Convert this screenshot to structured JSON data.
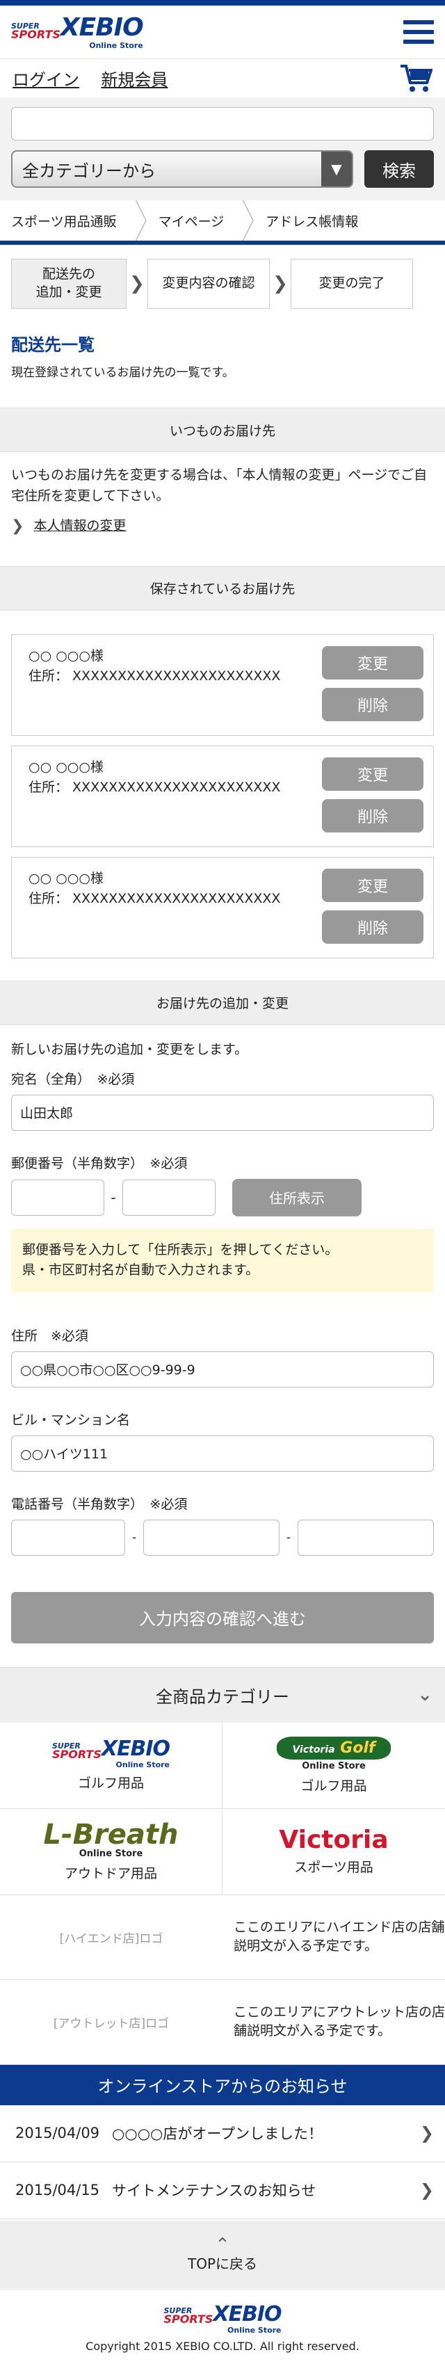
{
  "header": {
    "logo_super": "SUPER",
    "logo_sports": "SPORTS",
    "logo_xebio": "XEBIO",
    "logo_online": "Online Store"
  },
  "account": {
    "login": "ログイン",
    "register": "新規会員"
  },
  "search": {
    "placeholder": "",
    "category": "全カテゴリーから",
    "button": "検索"
  },
  "breadcrumb": [
    "スポーツ用品通販",
    "マイページ",
    "アドレス帳情報"
  ],
  "steps": [
    {
      "label": "配送先の\n追加・変更"
    },
    {
      "label": "変更内容の確認"
    },
    {
      "label": "変更の完了"
    }
  ],
  "page": {
    "title": "配送先一覧",
    "desc": "現在登録されているお届け先の一覧です。"
  },
  "usual": {
    "heading": "いつものお届け先",
    "text": "いつものお届け先を変更する場合は、「本人情報の変更」ページでご自宅住所を変更して下さい。",
    "link": "本人情報の変更"
  },
  "saved": {
    "heading": "保存されているお届け先",
    "entries": [
      {
        "name": "○○ ○○○様",
        "address": "住所： XXXXXXXXXXXXXXXXXXXXXXX"
      },
      {
        "name": "○○ ○○○様",
        "address": "住所： XXXXXXXXXXXXXXXXXXXXXXX"
      },
      {
        "name": "○○ ○○○様",
        "address": "住所： XXXXXXXXXXXXXXXXXXXXXXX"
      }
    ],
    "edit": "変更",
    "delete": "削除"
  },
  "form": {
    "heading": "お届け先の追加・変更",
    "intro": "新しいお届け先の追加・変更をします。",
    "name_label": "宛名（全角）　※必須",
    "name_value": "山田太郎",
    "zip_label": "郵便番号（半角数字）　※必須",
    "zip_dash": "-",
    "lookup": "住所表示",
    "notice": "郵便番号を入力して「住所表示」を押してください。\n県・市区町村名が自動で入力されます。",
    "addr_label": "住所　※必須",
    "addr_value": "○○県○○市○○区○○9-99-9",
    "bldg_label": "ビル・マンション名",
    "bldg_value": "○○ハイツ111",
    "tel_label": "電話番号（半角数字）　※必須",
    "tel_dash": "-",
    "confirm": "入力内容の確認へ進む"
  },
  "categories": {
    "heading": "全商品カテゴリー",
    "brands": [
      {
        "label": "ゴルフ用品",
        "logo": "SUPER SPORTS XEBIO Online Store"
      },
      {
        "label": "ゴルフ用品",
        "logo": "Victoria Golf Online Store"
      },
      {
        "label": "アウトドア用品",
        "logo": "L-Breath Online Store"
      },
      {
        "label": "スポーツ用品",
        "logo": "Victoria"
      }
    ],
    "vg_victoria": "Victoria",
    "vg_golf": "Golf",
    "vg_online": "Online Store",
    "lb_name": "L-Breath",
    "lb_online": "Online Store",
    "victoria": "Victoria"
  },
  "shops": [
    {
      "logo": "[ハイエンド店]ロゴ",
      "desc": "ここのエリアにハイエンド店の店舗説明文が入る予定です。"
    },
    {
      "logo": "[アウトレット店]ロゴ",
      "desc": "ここのエリアにアウトレット店の店舗説明文が入る予定です。"
    }
  ],
  "news": {
    "heading": "オンラインストアからのお知らせ",
    "items": [
      {
        "date": "2015/04/09",
        "text": "○○○○店がオープンしました！"
      },
      {
        "date": "2015/04/15",
        "text": "サイトメンテナンスのお知らせ"
      }
    ]
  },
  "totop": "TOPに戻る",
  "footer": {
    "copyright": "Copyright 2015 XEBIO CO.LTD. All right reserved."
  },
  "colors": {
    "brand_blue": "#0b3a8f",
    "brand_red": "#d4162c",
    "button_gray": "#999999",
    "notice_bg": "#fff8d9"
  }
}
